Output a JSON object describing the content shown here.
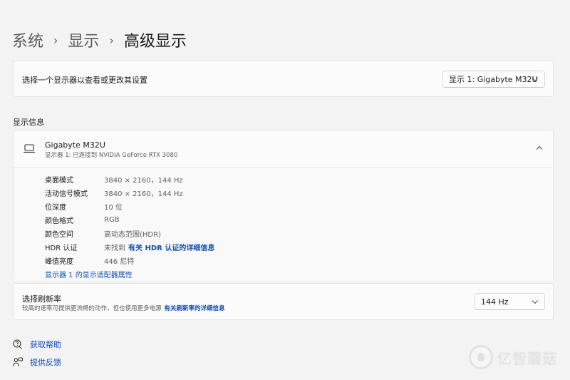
{
  "breadcrumb": {
    "items": [
      "系统",
      "显示",
      "高级显示"
    ],
    "separator": "›"
  },
  "select_display": {
    "label": "选择一个显示器以查看或更改其设置",
    "dropdown_value": "显示 1: Gigabyte M32U"
  },
  "display_info": {
    "section_title": "显示信息",
    "monitor_name": "Gigabyte M32U",
    "monitor_sub": "显示器 1: 已连接到 NVIDIA GeForce RTX 3080",
    "properties": [
      {
        "key": "桌面模式",
        "value": "3840 × 2160，144 Hz"
      },
      {
        "key": "活动信号模式",
        "value": "3840 × 2160，144 Hz"
      },
      {
        "key": "位深度",
        "value": "10 位"
      },
      {
        "key": "颜色格式",
        "value": "RGB"
      },
      {
        "key": "颜色空间",
        "value": "高动态范围(HDR)"
      },
      {
        "key": "HDR 认证",
        "value": "未找到",
        "link": "有关 HDR 认证的详细信息"
      },
      {
        "key": "峰值亮度",
        "value": "446 尼特"
      }
    ],
    "adapter_link": "显示器 1 的显示适配器属性"
  },
  "refresh_rate": {
    "title": "选择刷新率",
    "description": "较高的速率可提供更流畅的动作，但也使用更多电源",
    "link": "有关刷新率的详细信息",
    "dropdown_value": "144 Hz"
  },
  "help": {
    "get_help": "获取帮助",
    "feedback": "提供反馈"
  },
  "watermark": {
    "text": "亿智蘑菇"
  },
  "colors": {
    "background": "#f3f3f3",
    "card": "#fbfbfb",
    "link": "#0f4cb0",
    "text_primary": "#1b1b1b",
    "text_secondary": "#5f5f5f"
  },
  "icons": {
    "monitor": "laptop-icon",
    "help": "help-chat-icon",
    "feedback": "feedback-icon",
    "expand": "chevron-up-icon",
    "dropdown": "chevron-down-icon"
  }
}
